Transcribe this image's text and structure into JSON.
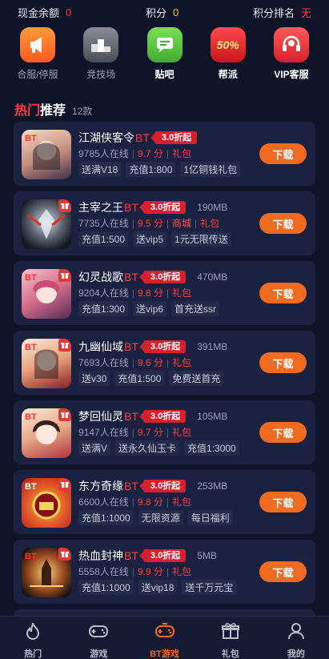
{
  "stats": {
    "cash_label": "现金余额",
    "cash_value": "0",
    "points_label": "积分",
    "points_value": "0",
    "rank_label": "积分排名",
    "rank_value": "无"
  },
  "quick": [
    {
      "label": "合服/停服",
      "icon": "megaphone-icon"
    },
    {
      "label": "竞技场",
      "icon": "podium-icon"
    },
    {
      "label": "贴吧",
      "icon": "chat-icon"
    },
    {
      "label": "帮派",
      "icon": "discount-badge-icon",
      "badge": "50%"
    },
    {
      "label": "VIP客服",
      "icon": "headset-icon"
    }
  ],
  "section": {
    "title_red": "热门",
    "title_white": "推荐",
    "count": "12款"
  },
  "games": [
    {
      "name": "江湖侠客令",
      "bt": "BT",
      "discount": "3.0折起",
      "size": "",
      "online": "9785人在线",
      "score": "9.7 分",
      "tag1": "礼包",
      "tag2": "",
      "chips": [
        "送满V18",
        "充值1:800",
        "1亿铜钱礼包"
      ],
      "button": "下载"
    },
    {
      "name": "主宰之王",
      "bt": "BT",
      "discount": "3.0折起",
      "size": "190MB",
      "online": "7735人在线",
      "score": "9.5 分",
      "tag1": "商城",
      "tag2": "礼包",
      "chips": [
        "充值1:500",
        "送vip5",
        "1元无限传送"
      ],
      "button": "下载"
    },
    {
      "name": "幻灵战歌",
      "bt": "BT",
      "discount": "3.0折起",
      "size": "470MB",
      "online": "9204人在线",
      "score": "9.8 分",
      "tag1": "礼包",
      "tag2": "",
      "chips": [
        "充值1:300",
        "送vip6",
        "首充送ssr"
      ],
      "button": "下载"
    },
    {
      "name": "九幽仙域",
      "bt": "BT",
      "discount": "3.0折起",
      "size": "391MB",
      "online": "7693人在线",
      "score": "9.6 分",
      "tag1": "礼包",
      "tag2": "",
      "chips": [
        "送v30",
        "充值1:500",
        "免费送首充"
      ],
      "button": "下载"
    },
    {
      "name": "梦回仙灵",
      "bt": "BT",
      "discount": "3.0折起",
      "size": "105MB",
      "online": "9147人在线",
      "score": "9.7 分",
      "tag1": "礼包",
      "tag2": "",
      "chips": [
        "送满V",
        "送永久仙玉卡",
        "充值1:3000"
      ],
      "button": "下载"
    },
    {
      "name": "东方奇缘",
      "bt": "BT",
      "discount": "3.0折起",
      "size": "253MB",
      "online": "6600人在线",
      "score": "9.8 分",
      "tag1": "礼包",
      "tag2": "",
      "chips": [
        "充值1:1000",
        "无限资源",
        "每日福利"
      ],
      "button": "下载"
    },
    {
      "name": "热血封神",
      "bt": "BT",
      "discount": "3.0折起",
      "size": "5MB",
      "online": "5558人在线",
      "score": "9.9 分",
      "tag1": "礼包",
      "tag2": "",
      "chips": [
        "充值1:1000",
        "送vip18",
        "送千万元宝"
      ],
      "button": "下载"
    }
  ],
  "nav": [
    {
      "label": "热门",
      "icon": "flame-icon",
      "active": false
    },
    {
      "label": "游戏",
      "icon": "gamepad-icon",
      "active": false
    },
    {
      "label": "BT游戏",
      "icon": "controller-icon",
      "active": true
    },
    {
      "label": "礼包",
      "icon": "gift-icon",
      "active": false
    },
    {
      "label": "我的",
      "icon": "user-icon",
      "active": false
    }
  ],
  "colors": {
    "background": "#0f1428",
    "card": "#1b2140",
    "accent_red": "#ff3b3b",
    "download_orange": "#f06a1f",
    "discount_red": "#d8202c"
  }
}
